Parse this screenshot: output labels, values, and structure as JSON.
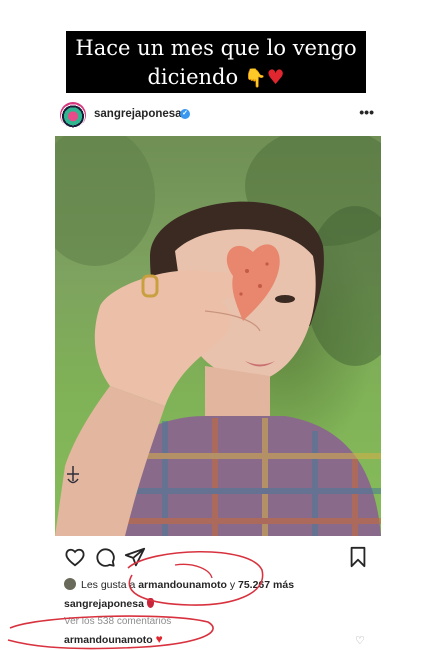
{
  "story": {
    "caption_line1": "Hace un mes que lo vengo",
    "caption_line2": "diciendo",
    "emoji_hand": "👇",
    "emoji_heart": "♥"
  },
  "post": {
    "username": "sangrejaponesa",
    "verified_mark": "✓",
    "more_label": "•••"
  },
  "engagement": {
    "likes_prefix": "Les gusta a",
    "likes_user": "armandounamoto",
    "likes_joiner": "y",
    "likes_count": "75.267 más",
    "caption_user": "sangrejaponesa",
    "view_comments": "Ver los 538 comentarios",
    "comment_user": "armandounamoto",
    "comment_heart": "♥"
  },
  "colors": {
    "accent_red": "#e0262f",
    "verified_blue": "#3897f0",
    "scribble_red": "#d8323f"
  },
  "icons": [
    "heart-icon",
    "comment-icon",
    "share-icon",
    "bookmark-icon",
    "verified-icon",
    "more-icon"
  ]
}
